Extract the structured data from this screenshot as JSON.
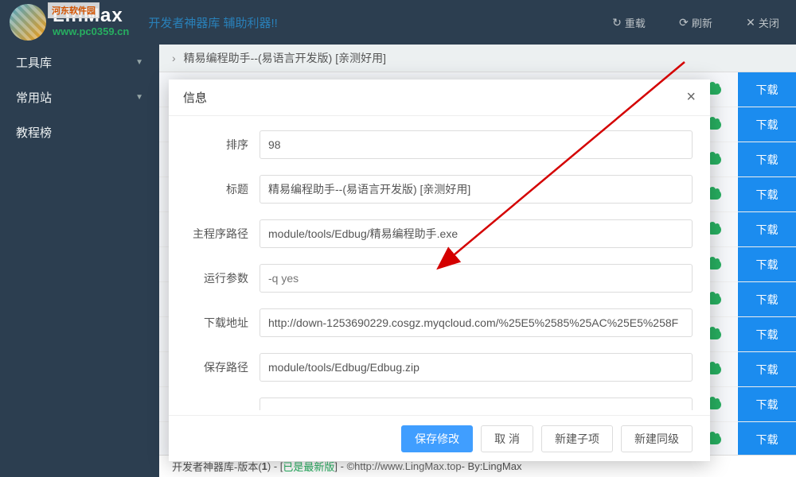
{
  "header": {
    "logo_title": "LinMax",
    "logo_sub": "www.pc0359.cn",
    "overlay_badge": "河东软件园",
    "tagline": "开发者神器库 辅助利器!!",
    "actions": {
      "reload": "重载",
      "refresh": "刷新",
      "close": "关闭"
    }
  },
  "sidebar": {
    "items": [
      {
        "label": "工具库",
        "has_caret": true
      },
      {
        "label": "常用站",
        "has_caret": true
      },
      {
        "label": "教程榜",
        "has_caret": false
      }
    ]
  },
  "breadcrumb": {
    "text": "精易编程助手--(易语言开发版) [亲测好用]"
  },
  "list": {
    "download_label": "下载",
    "row_count": 11
  },
  "modal": {
    "title": "信息",
    "fields": {
      "sort": {
        "label": "排序",
        "value": "98"
      },
      "title": {
        "label": "标题",
        "value": "精易编程助手--(易语言开发版) [亲测好用]"
      },
      "main_path": {
        "label": "主程序路径",
        "value": "module/tools/Edbug/精易编程助手.exe"
      },
      "run_args": {
        "label": "运行参数",
        "placeholder": "-q yes",
        "value": ""
      },
      "download_url": {
        "label": "下载地址",
        "value": "http://down-1253690229.cosgz.myqcloud.com/%25E5%2585%25AC%25E5%258F"
      },
      "save_path": {
        "label": "保存路径",
        "value": "module/tools/Edbug/Edbug.zip"
      }
    },
    "buttons": {
      "save": "保存修改",
      "cancel": "取 消",
      "new_child": "新建子项",
      "new_sibling": "新建同级"
    }
  },
  "footer": {
    "prefix": "开发者神器库-版本(",
    "version": "1",
    "mid": ") - [",
    "latest": "已是最新版",
    "after": "] - © ",
    "link": "http://www.LingMax.top",
    "by": " - By:LingMax"
  }
}
